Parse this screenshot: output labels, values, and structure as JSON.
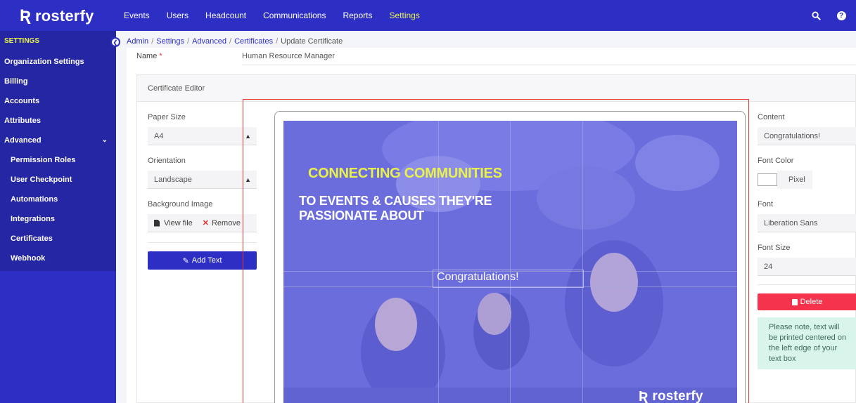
{
  "brand": {
    "name": "rosterfy",
    "mark": "Ʀ"
  },
  "topnav": [
    {
      "label": "Events"
    },
    {
      "label": "Users"
    },
    {
      "label": "Headcount"
    },
    {
      "label": "Communications"
    },
    {
      "label": "Reports"
    },
    {
      "label": "Settings"
    }
  ],
  "topicons": {
    "search": "search-icon",
    "help": "help-icon",
    "help_glyph": "?"
  },
  "sidebar": {
    "heading": "SETTINGS",
    "items": [
      {
        "label": "Organization Settings"
      },
      {
        "label": "Billing"
      },
      {
        "label": "Accounts"
      },
      {
        "label": "Attributes"
      },
      {
        "label": "Advanced"
      }
    ],
    "subitems": [
      {
        "label": "Permission Roles"
      },
      {
        "label": "User Checkpoint"
      },
      {
        "label": "Automations"
      },
      {
        "label": "Integrations"
      },
      {
        "label": "Certificates"
      },
      {
        "label": "Webhook"
      }
    ]
  },
  "breadcrumb": {
    "links": [
      "Admin",
      "Settings",
      "Advanced",
      "Certificates"
    ],
    "current": "Update Certificate",
    "separator": "/"
  },
  "form": {
    "name_label": "Name",
    "required_mark": "*",
    "name_value": "Human Resource Manager"
  },
  "editor": {
    "title": "Certificate Editor",
    "paper_size_label": "Paper Size",
    "paper_size_value": "A4",
    "orientation_label": "Orientation",
    "orientation_value": "Landscape",
    "background_label": "Background Image",
    "view_file": "View file",
    "remove": "Remove",
    "add_text": "Add Text"
  },
  "certificate": {
    "headline_1": "CONNECTING COMMUNITIES",
    "headline_2a": "TO EVENTS & CAUSES THEY'RE",
    "headline_2b": "PASSIONATE ABOUT",
    "text_element": "Congratulations!",
    "logo_text": "rosterfy"
  },
  "properties": {
    "content_label": "Content",
    "content_value": "Congratulations!",
    "font_color_label": "Font Color",
    "font_color_value": "Pixel",
    "font_label": "Font",
    "font_value": "Liberation Sans",
    "font_size_label": "Font Size",
    "font_size_value": "24",
    "delete_label": "Delete",
    "note": "Please note, text will be printed centered on the left edge of your text box"
  },
  "colors": {
    "brand": "#2d2fc4",
    "active_nav": "#e8f24a",
    "danger": "#f5334d",
    "note_bg": "#d9f4ea"
  }
}
